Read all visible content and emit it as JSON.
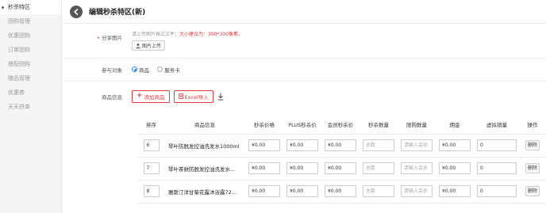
{
  "sidebar": {
    "items": [
      {
        "label": "秒杀特区",
        "active": true
      },
      {
        "label": "团购管理",
        "active": false
      },
      {
        "label": "优惠团购",
        "active": false
      },
      {
        "label": "订单团购",
        "active": false
      },
      {
        "label": "搭配团购",
        "active": false
      },
      {
        "label": "赠品管理",
        "active": false
      },
      {
        "label": "优惠券",
        "active": false
      },
      {
        "label": "天天拼单",
        "active": false
      }
    ]
  },
  "header": {
    "title": "编辑秒杀特区(新)",
    "back_icon": "back-arrow-icon"
  },
  "form": {
    "image": {
      "label": "分享图片",
      "hint_prefix": "请上传图片格式文件；",
      "hint_red": "大小建议为：300*300像素。",
      "upload_label": "图片上传"
    },
    "target": {
      "label": "参与对象",
      "options": [
        {
          "label": "商品",
          "selected": true
        },
        {
          "label": "服务卡",
          "selected": false
        }
      ]
    },
    "products": {
      "label": "商品信息",
      "add_label": "添加商品",
      "import_label": "Excel导入"
    }
  },
  "table": {
    "headers": [
      "排序",
      "商品信息",
      "秒杀价格",
      "PLUS秒杀价",
      "会员秒杀价",
      "秒杀数量",
      "限购数量",
      "佣金",
      "虚拟销量",
      "操作"
    ],
    "rows": [
      {
        "sort": "6",
        "name": "琴叶防脱发控油洗发水1000ml",
        "price": "¥0.00",
        "plus": "¥0.00",
        "member": "¥0.00",
        "qty_placeholder": "总数",
        "limit_placeholder": "请输入会员",
        "commission": "¥0.00",
        "virtual": "0",
        "action": "删除"
      },
      {
        "sort": "7",
        "name": "琴叶茶麸防脱发控油洗发水...",
        "price": "¥0.00",
        "plus": "¥0.00",
        "member": "¥0.00",
        "qty_placeholder": "总数",
        "limit_placeholder": "请输入会员",
        "commission": "¥0.00",
        "virtual": "0",
        "action": "删除"
      },
      {
        "sort": "8",
        "name": "雅斯汀洋甘菊花露沐浴露72...",
        "price": "¥0.00",
        "plus": "¥0.00",
        "member": "¥0.00",
        "qty_placeholder": "总数",
        "limit_placeholder": "请输入会员",
        "commission": "¥0.00",
        "virtual": "0",
        "action": "删除"
      }
    ]
  },
  "colors": {
    "accent_red": "#e4393c",
    "radio_blue": "#2d8cf0"
  }
}
